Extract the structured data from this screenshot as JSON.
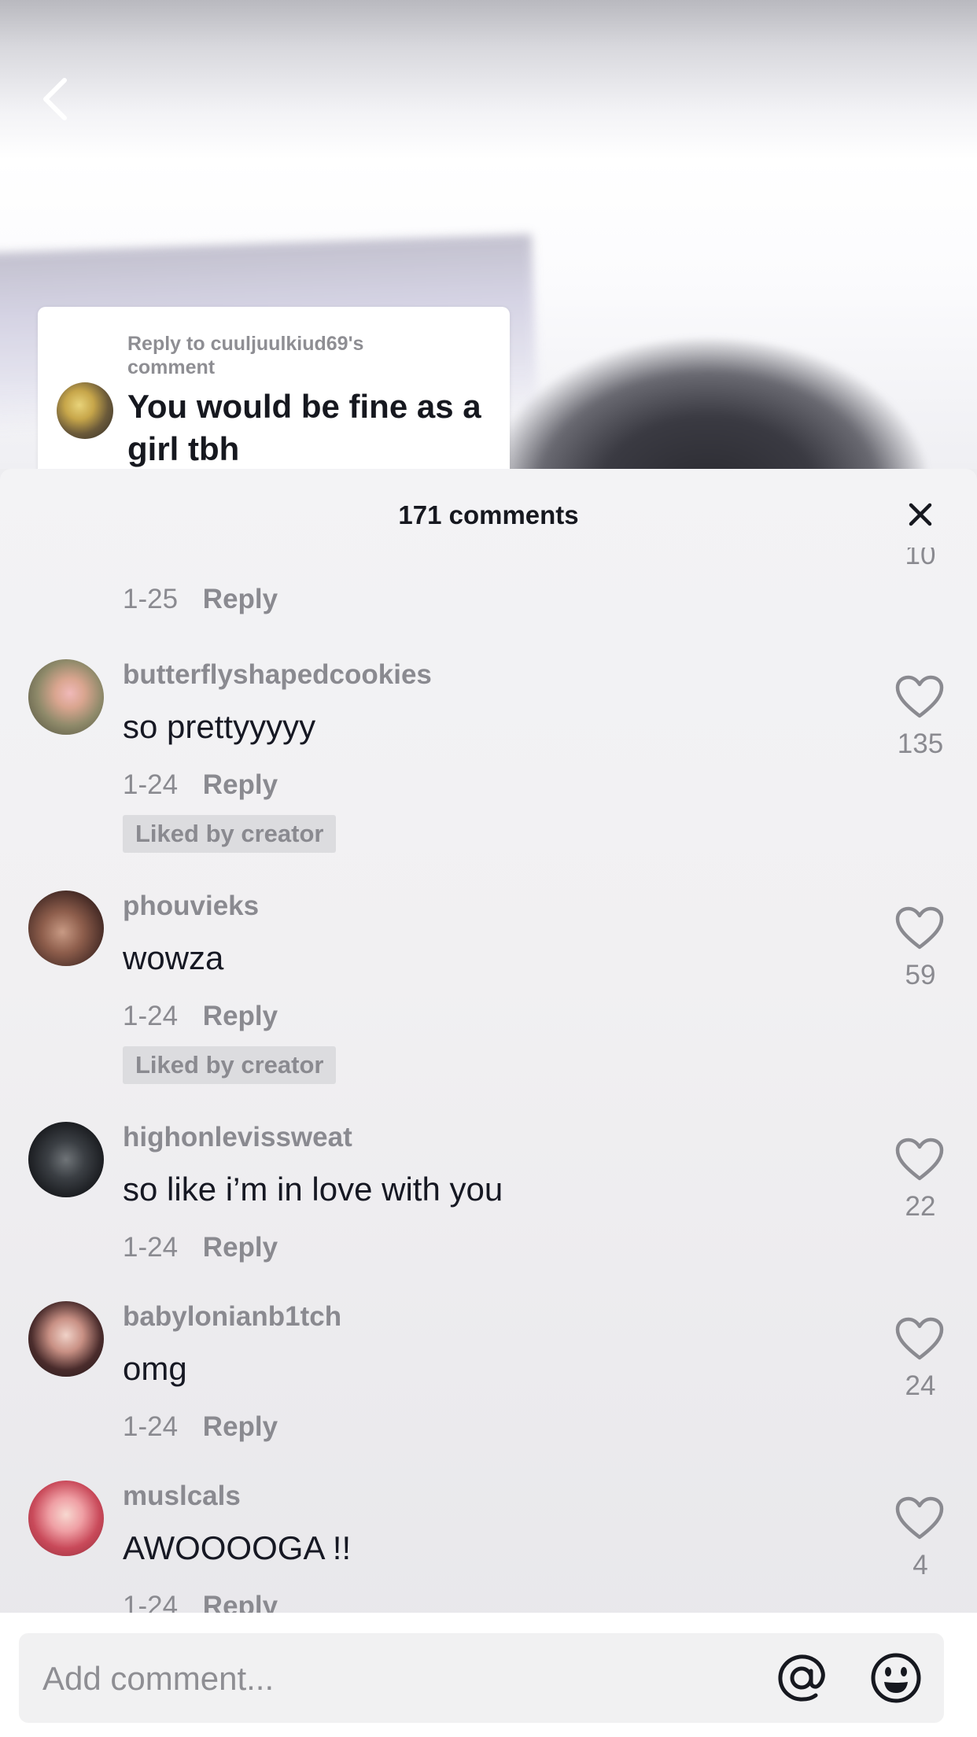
{
  "reply_card": {
    "reply_to": "Reply to cuuljuulkiud69's comment",
    "text": "You would be fine as a girl tbh"
  },
  "panel": {
    "title": "171 comments"
  },
  "partial_comment": {
    "date": "1-25",
    "reply_label": "Reply",
    "like_count": "10"
  },
  "comments": [
    {
      "username": "butterflyshapedcookies",
      "text": "so prettyyyyy",
      "date": "1-24",
      "reply_label": "Reply",
      "likes": "135",
      "badge": "Liked by creator"
    },
    {
      "username": "phouvieks",
      "text": "wowza",
      "date": "1-24",
      "reply_label": "Reply",
      "likes": "59",
      "badge": "Liked by creator"
    },
    {
      "username": "highonlevissweat",
      "text": "so like i’m in love with you",
      "date": "1-24",
      "reply_label": "Reply",
      "likes": "22"
    },
    {
      "username": "babylonianb1tch",
      "text": "omg",
      "date": "1-24",
      "reply_label": "Reply",
      "likes": "24"
    },
    {
      "username": "muslcals",
      "text": "AWOOOOGA !!",
      "date": "1-24",
      "reply_label": "Reply",
      "likes": "4"
    }
  ],
  "composer": {
    "placeholder": "Add comment..."
  },
  "icons": {
    "back": "chevron-left-icon",
    "close": "close-icon",
    "like": "heart-outline-icon",
    "mention": "at-sign-icon",
    "emoji": "smiley-icon"
  },
  "colors": {
    "muted_text": "#8a8a90",
    "primary_text": "#161823",
    "badge_bg": "#dcdcdf"
  }
}
